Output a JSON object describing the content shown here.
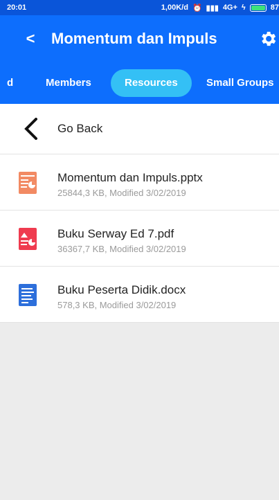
{
  "status": {
    "time": "20:01",
    "right_text": "1,00K/d",
    "network": "4G+",
    "battery": "87"
  },
  "appbar": {
    "back_glyph": "<",
    "title": "Momentum dan Impuls",
    "settings_icon": "gear-icon"
  },
  "tabs": {
    "items": [
      {
        "label": "d"
      },
      {
        "label": "Members"
      },
      {
        "label": "Resources",
        "active": true
      },
      {
        "label": "Small Groups"
      }
    ],
    "active_color": "#34c0f5"
  },
  "list": {
    "go_back": "Go Back",
    "files": [
      {
        "name": "Momentum dan Impuls.pptx",
        "meta": "25844,3 KB, Modified 3/02/2019",
        "icon": "presentation-file-icon",
        "color": "#f28a63"
      },
      {
        "name": "Buku Serway Ed 7.pdf",
        "meta": "36367,7 KB, Modified 3/02/2019",
        "icon": "pdf-file-icon",
        "color": "#ef3b4f"
      },
      {
        "name": "Buku Peserta Didik.docx",
        "meta": "578,3 KB, Modified 3/02/2019",
        "icon": "document-file-icon",
        "color": "#2d6fdb"
      }
    ]
  },
  "colors": {
    "appbar": "#0d6efd",
    "background": "#ececec"
  }
}
